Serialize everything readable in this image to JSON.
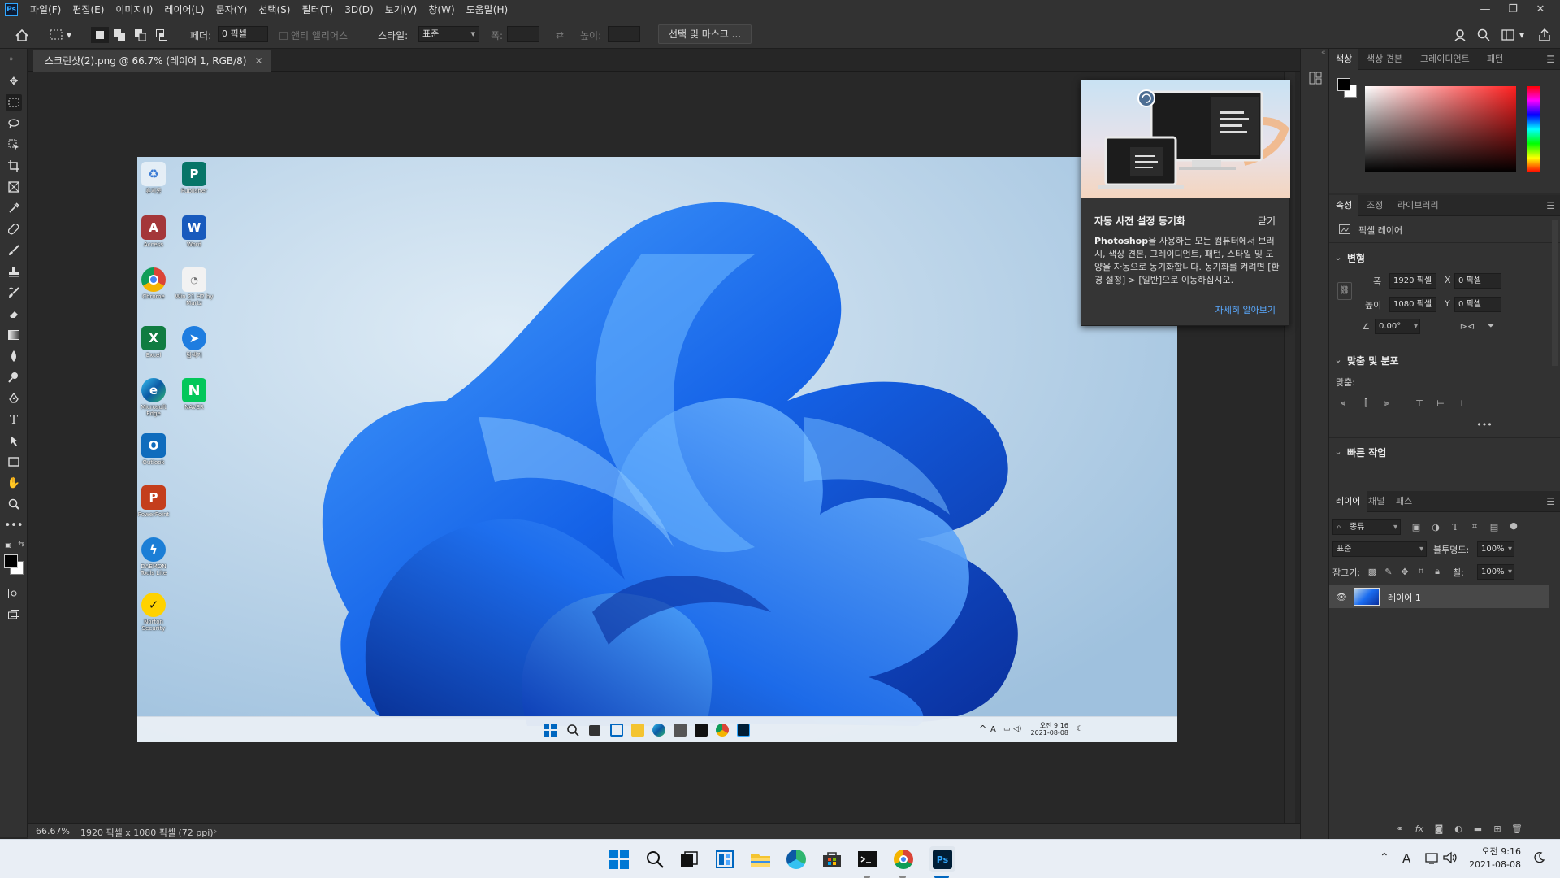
{
  "menubar": {
    "items": [
      "파일(F)",
      "편집(E)",
      "이미지(I)",
      "레이어(L)",
      "문자(Y)",
      "선택(S)",
      "필터(T)",
      "3D(D)",
      "보기(V)",
      "창(W)",
      "도움말(H)"
    ],
    "logo": "Ps"
  },
  "options": {
    "feather_label": "페더:",
    "feather_value": "0 픽셀",
    "antialias_label": "앤티 앨리어스",
    "style_label": "스타일:",
    "style_value": "표준",
    "width_label": "폭:",
    "height_label": "높이:",
    "select_mask_label": "선택 및 마스크 ..."
  },
  "document": {
    "tab_title": "스크린샷(2).png @ 66.7% (레이어 1, RGB/8)",
    "desktop_icons": [
      {
        "label": "휴지통"
      },
      {
        "label": "Publisher"
      },
      {
        "label": "Access"
      },
      {
        "label": "Word"
      },
      {
        "label": "Chrome"
      },
      {
        "label": "Win 21 H2 by Martz"
      },
      {
        "label": "Excel"
      },
      {
        "label": "탐색기"
      },
      {
        "label": "Microsoft Edge"
      },
      {
        "label": "NAVER"
      },
      {
        "label": "Outlook"
      },
      {
        "label": "PowerPoint"
      },
      {
        "label": "DAEMON Tools Lite"
      },
      {
        "label": "Norton Security"
      }
    ],
    "taskbar_time": "오전 9:16",
    "taskbar_date": "2021-08-08",
    "taskbar_lang": "A"
  },
  "status": {
    "zoom": "66.67%",
    "info": "1920 픽셀 x 1080 픽셀 (72 ppi)"
  },
  "popup": {
    "title": "자동 사전 설정 동기화",
    "close": "닫기",
    "body_app": "Photoshop",
    "body_text": "을 사용하는 모든 컴퓨터에서 브러시, 색상 견본, 그레이디언트, 패턴, 스타일 및 모양을 자동으로 동기화합니다. 동기화를 켜려면 [환경 설정] > [일반]으로 이동하십시오.",
    "link": "자세히 알아보기"
  },
  "color_panel": {
    "tabs": [
      "색상",
      "색상 견본",
      "그레이디언트",
      "패턴"
    ]
  },
  "properties_panel": {
    "tabs": [
      "속성",
      "조정",
      "라이브러리"
    ],
    "layer_type": "픽셀 레이어",
    "transform_title": "변형",
    "w_label": "폭",
    "w_value": "1920 픽셀",
    "x_label": "X",
    "x_value": "0 픽셀",
    "h_label": "높이",
    "h_value": "1080 픽셀",
    "y_label": "Y",
    "y_value": "0 픽셀",
    "angle_value": "0.00°",
    "align_title": "맞춤 및 분포",
    "align_label": "맞춤:",
    "quick_title": "빠른 작업"
  },
  "layers_panel": {
    "tabs": [
      "레이어",
      "채널",
      "패스"
    ],
    "filter_label": "종류",
    "blend_mode": "표준",
    "opacity_label": "불투명도:",
    "opacity_value": "100%",
    "lock_label": "잠그기:",
    "fill_label": "칠:",
    "fill_value": "100%",
    "layer_name": "레이어 1"
  },
  "taskbar": {
    "time": "오전 9:16",
    "date": "2021-08-08",
    "lang": "A",
    "ps_label": "Ps"
  },
  "colors": {
    "accent": "#31a8ff",
    "win_blue": "#0067c0",
    "bloom": "#1a6cf0"
  }
}
